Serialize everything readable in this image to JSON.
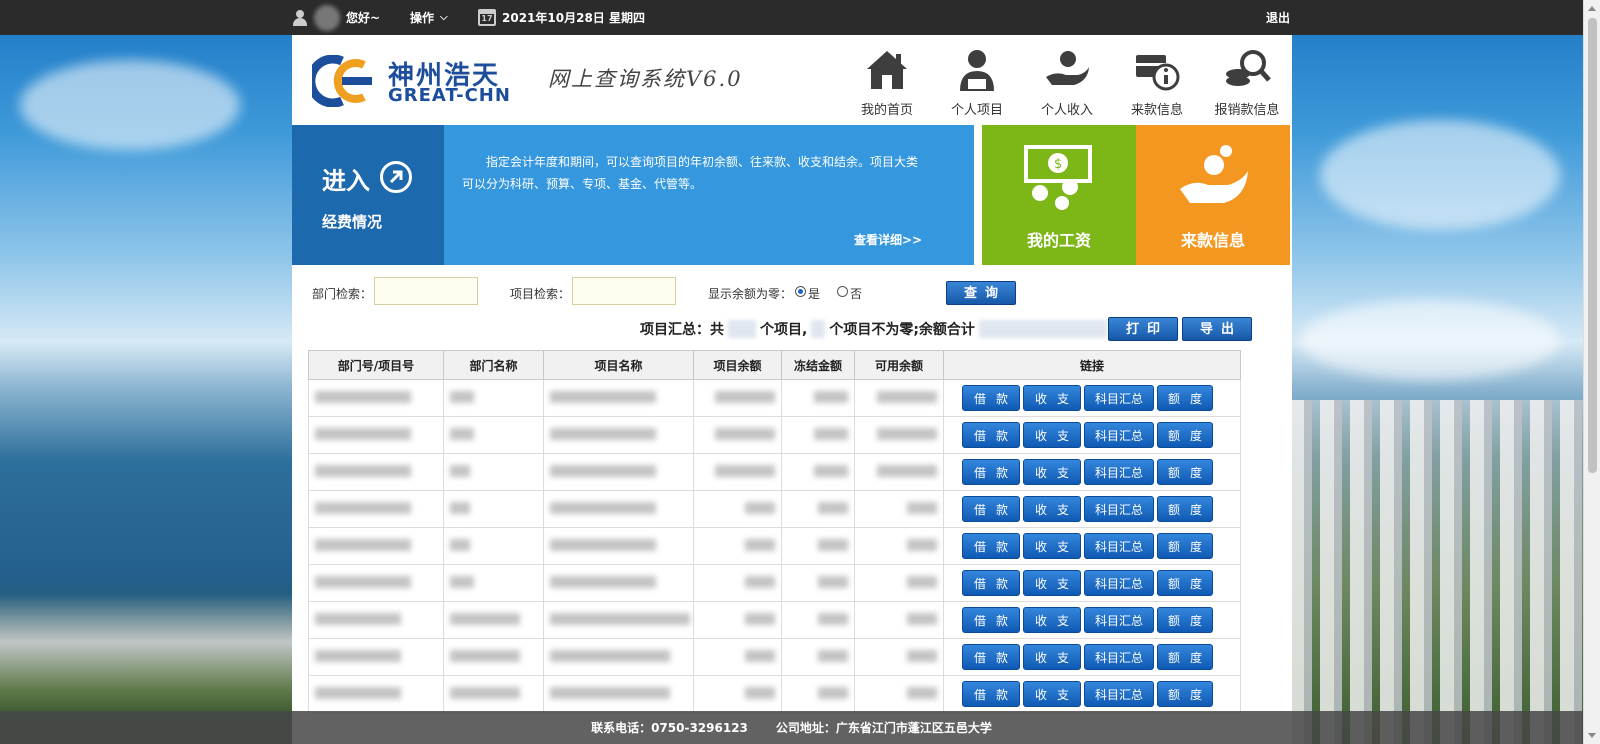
{
  "topbar": {
    "greeting": "您好~",
    "operate": "操作",
    "date": "2021年10月28日 星期四",
    "calendar_day": "17",
    "logout": "退出"
  },
  "header": {
    "logo_cn": "神州浩天",
    "logo_en": "GREAT-CHN",
    "system_title": "网上查询系统V6.0",
    "nav": [
      {
        "label": "我的首页",
        "icon": "home-icon"
      },
      {
        "label": "个人项目",
        "icon": "person-icon"
      },
      {
        "label": "个人收入",
        "icon": "income-hand-icon"
      },
      {
        "label": "来款信息",
        "icon": "money-info-icon"
      },
      {
        "label": "报销款信息",
        "icon": "coin-search-icon"
      }
    ]
  },
  "banner": {
    "enter_title": "进入",
    "enter_sub": "经费情况",
    "description": "指定会计年度和期间，可以查询项目的年初余额、往来款、收支和结余。项目大类可以分为科研、预算、专项、基金、代管等。",
    "more": "查看详细>>",
    "salary": "我的工资",
    "income": "来款信息"
  },
  "search": {
    "dept_label": "部门检索：",
    "dept_value": "",
    "project_label": "项目检索：",
    "project_value": "",
    "zero_label": "显示余额为零：",
    "opt_yes": "是",
    "opt_no": "否",
    "query": "查询",
    "print": "打印",
    "export": "导出",
    "summary_a": "项目汇总：共",
    "summary_b": "个项目,",
    "summary_c": "个项目不为零;余额合计",
    "summary_d": "。"
  },
  "table": {
    "headers": [
      "部门号/项目号",
      "部门名称",
      "项目名称",
      "项目余额",
      "冻结金额",
      "可用余额",
      "链接"
    ],
    "actions": [
      "借款",
      "收支",
      "科目汇总",
      "额度"
    ]
  },
  "footer": {
    "phone": "联系电话：0750-3296123",
    "address": "公司地址：广东省江门市蓬江区五邑大学"
  },
  "colors": {
    "topbar": "#2b2b2b",
    "tile_enter": "#1d69ad",
    "tile_desc": "#3597dd",
    "tile_salary": "#7cb617",
    "tile_income": "#f39721",
    "button_blue": "#1658a8"
  }
}
